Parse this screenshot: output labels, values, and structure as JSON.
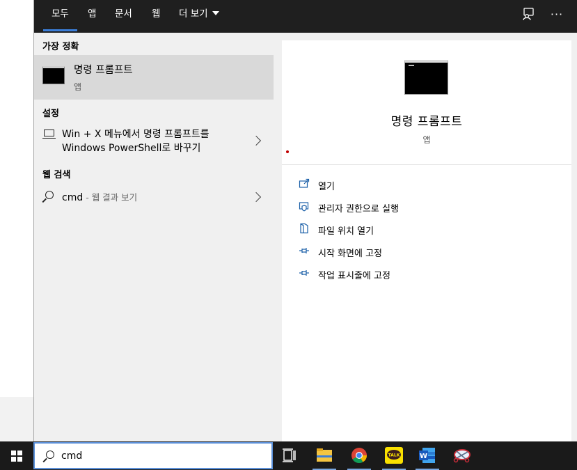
{
  "tabs": [
    {
      "label": "모두",
      "active": true
    },
    {
      "label": "앱"
    },
    {
      "label": "문서"
    },
    {
      "label": "웹"
    },
    {
      "label": "더 보기"
    }
  ],
  "top_icons": [
    "feedback-icon",
    "more-options-icon"
  ],
  "more_glyph": "···",
  "best_match": {
    "section": "가장 정확",
    "title": "명령 프롬프트",
    "subtitle": "앱"
  },
  "settings": {
    "section": "설정",
    "item_line1": "Win + X 메뉴에서 명령 프롬프트를",
    "item_line2": "Windows PowerShell로 바꾸기"
  },
  "web": {
    "section": "웹 검색",
    "query": "cmd",
    "suffix": " - 웹 결과 보기"
  },
  "preview": {
    "title": "명령 프롬프트",
    "subtitle": "앱",
    "actions": [
      {
        "label": "열기",
        "icon": "open-icon"
      },
      {
        "label": "관리자 권한으로 실행",
        "icon": "shield-icon"
      },
      {
        "label": "파일 위치 열기",
        "icon": "file-location-icon"
      },
      {
        "label": "시작 화면에 고정",
        "icon": "pin-icon"
      },
      {
        "label": "작업 표시줄에 고정",
        "icon": "pin-icon"
      }
    ]
  },
  "taskbar": {
    "search_value": "cmd",
    "kakao_label": "TALK",
    "word_label": "W",
    "apps": [
      "task-view-icon",
      "file-explorer-icon",
      "chrome-icon",
      "kakaotalk-icon",
      "word-icon",
      "snipping-tool-icon"
    ]
  },
  "colors": {
    "accent": "#3b7dd8",
    "topbar": "#1f1f1f",
    "panel": "#f0f0f0",
    "selected": "#d9d9d9",
    "action_icon": "#1a5fa8",
    "taskbar": "#1a1a1a"
  }
}
